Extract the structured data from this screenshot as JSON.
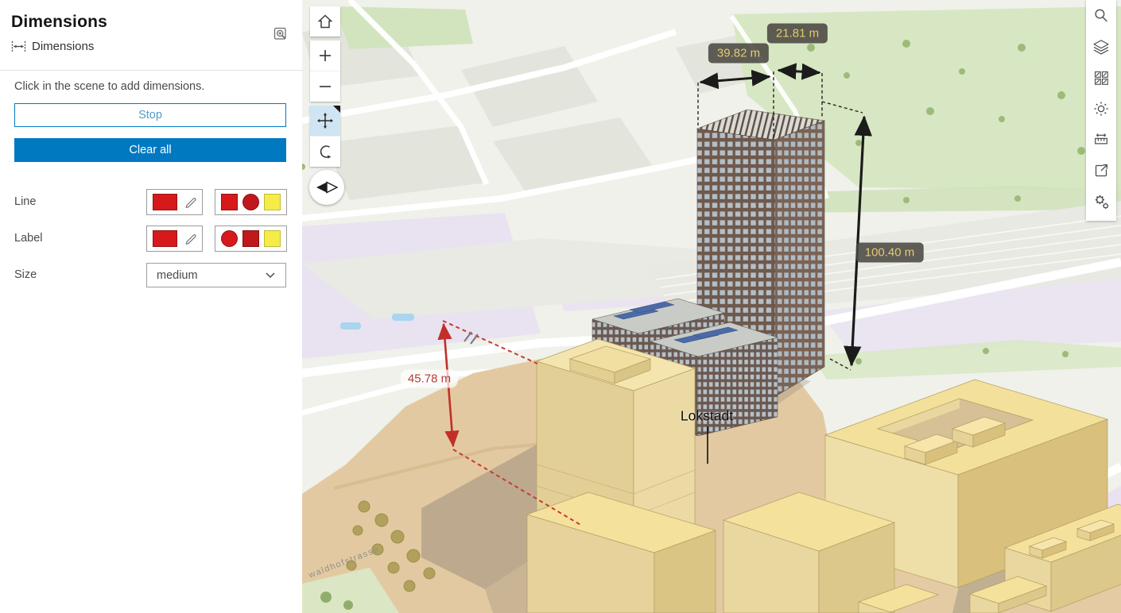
{
  "panel": {
    "title": "Dimensions",
    "subtitle": "Dimensions",
    "instruction": "Click in the scene to add dimensions.",
    "buttons": {
      "stop": "Stop",
      "clear_all": "Clear all"
    },
    "rows": {
      "line": "Line",
      "label": "Label",
      "size": "Size"
    },
    "size_value": "medium",
    "swatch_colors": {
      "red": "#d7191c",
      "dark_red": "#c0181c",
      "yellow": "#f5ec48"
    },
    "accent_color": "#0079c1",
    "icons": [
      "zoom-to-icon",
      "dimensions-widget-icon",
      "pencil-icon",
      "chevron-down-icon"
    ]
  },
  "map_controls": {
    "icons": [
      "home-icon",
      "zoom-in-icon",
      "zoom-out-icon",
      "pan-icon",
      "rotate-icon",
      "compass-icon"
    ],
    "active_tool": "pan",
    "active_bg": "#cfe5f3"
  },
  "toolbar": {
    "icons": [
      "search-icon",
      "layers-icon",
      "basemap-icon",
      "daylight-icon",
      "measurement-icon",
      "share-icon",
      "settings-icon"
    ]
  },
  "scene": {
    "dimension_labels": {
      "top_width": "21.81 m",
      "left_width": "39.82 m",
      "height": "100.40 m",
      "red_height": "45.78 m"
    },
    "building_label": "Lokstadt",
    "street_label": "waldhofstrasse",
    "label_style": {
      "bg": "#4a4842",
      "text": "#e5ca6e",
      "red_text": "#b63c36",
      "line_black": "#1b1b1b",
      "line_red": "#c22f2a"
    }
  }
}
